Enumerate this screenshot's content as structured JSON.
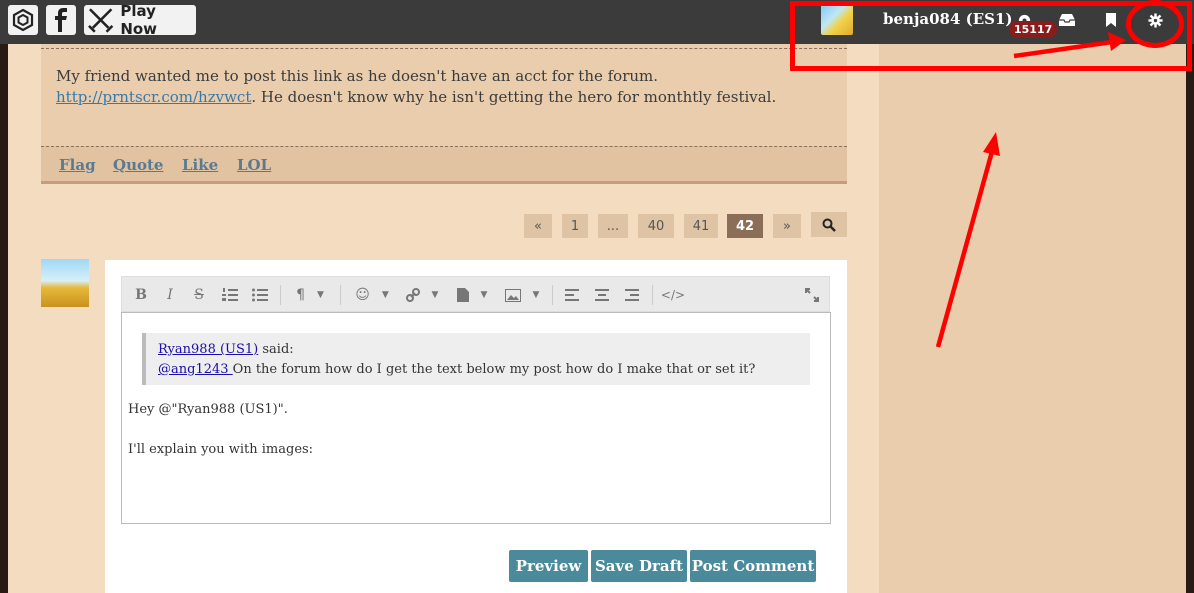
{
  "topbar": {
    "play_label": "Play Now",
    "username": "benja084 (ES1)",
    "badge_count": "15117"
  },
  "post": {
    "text_before": "My friend wanted me to post this link as he doesn't have an acct for the forum. ",
    "link": "http://prntscr.com/hzvwct",
    "text_after": ". He doesn't know why he isn't getting the hero for monthtly festival.",
    "actions": [
      "Flag",
      "Quote",
      "Like",
      "LOL"
    ]
  },
  "pagination": {
    "prev": "«",
    "pages": [
      "1",
      "...",
      "40",
      "41",
      "42"
    ],
    "active": "42",
    "next": "»"
  },
  "editor": {
    "quote_user": "Ryan988 (US1)",
    "quote_said": " said:",
    "quote_mention": "@ang1243 ",
    "quote_text": " On the forum how do I get the text below my post how do I make that or set it?",
    "line1": "Hey @\"Ryan988 (US1)\".",
    "line2": "I'll explain you with images:"
  },
  "buttons": {
    "preview": "Preview",
    "save_draft": "Save Draft",
    "post_comment": "Post Comment"
  },
  "colors": {
    "topbar": "#3b3b3b",
    "main_bg": "#f3dcc0",
    "sidebar_bg": "#e9cdad",
    "button": "#4a8a9a",
    "annotation": "#ff0000",
    "badge": "#8b1c1c"
  }
}
